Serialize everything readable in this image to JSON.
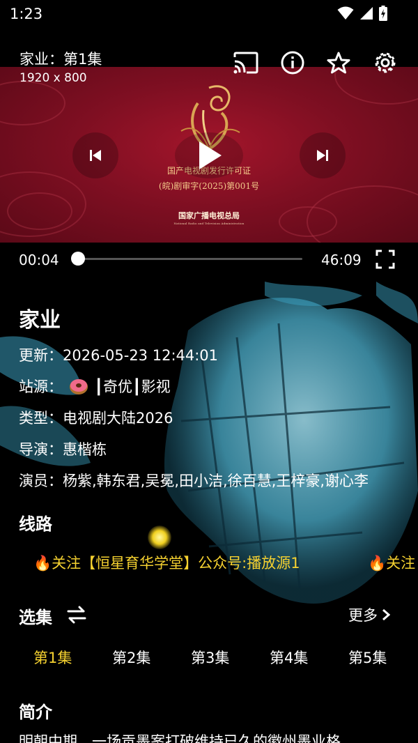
{
  "status_bar": {
    "time": "1:23"
  },
  "player": {
    "title": "家业：第1集",
    "resolution": "1920 x 800",
    "certificate_line1": "国产电视剧发行许可证",
    "certificate_line2": "(皖)剧审字(2025)第001号",
    "authority": "国家广播电视总局",
    "authority_en": "National Radio and Television Administration",
    "current_time": "00:04",
    "total_time": "46:09",
    "progress": 0.0014
  },
  "details": {
    "title": "家业",
    "update_label": "更新：",
    "update_value": "2026-05-23 12:44:01",
    "site_label": "站源：",
    "site_value": "┃奇优┃影视",
    "type_label": "类型：",
    "type_value": "电视剧大陆2026",
    "director_label": "导演：",
    "director_value": "惠楷栋",
    "cast_label": "演员：",
    "cast_value": "杨紫,韩东君,吴冕,田小洁,徐百慧,王梓豪,谢心李"
  },
  "routes": {
    "title": "线路",
    "items": [
      "🔥关注【恒星育华学堂】公众号:播放源1",
      "🔥关注"
    ]
  },
  "episodes": {
    "title": "选集",
    "more": "更多",
    "items": [
      "第1集",
      "第2集",
      "第3集",
      "第4集",
      "第5集"
    ],
    "active_index": 0
  },
  "intro": {
    "title": "简介",
    "text": "明朝中期，一场贡墨案打破维持已久的徽州墨业格"
  },
  "colors": {
    "accent": "#f5d130",
    "banner": "#8a1024"
  }
}
